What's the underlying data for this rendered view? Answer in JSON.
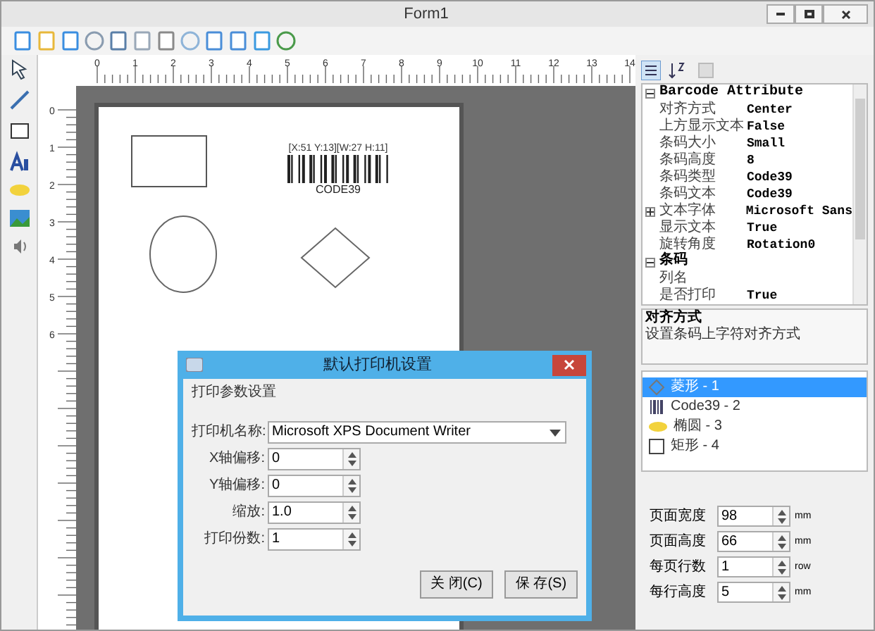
{
  "window": {
    "title": "Form1"
  },
  "rulers": {
    "top_labels": [
      "0",
      "1",
      "2",
      "3",
      "4",
      "5",
      "6",
      "7",
      "8",
      "9",
      "10",
      "11",
      "12",
      "13",
      "14"
    ],
    "left_labels": [
      "0",
      "1",
      "2",
      "3",
      "4",
      "5",
      "6"
    ]
  },
  "canvas": {
    "barcode": {
      "caption": "[X:51 Y:13][W:27 H:11]",
      "text": "CODE39"
    }
  },
  "property_grid": {
    "categories": [
      {
        "name": "Barcode Attribute",
        "expanded": true,
        "properties": [
          {
            "name": "对齐方式",
            "value": "Center",
            "expandable": false
          },
          {
            "name": "上方显示文本",
            "value": "False",
            "expandable": false
          },
          {
            "name": "条码大小",
            "value": "Small",
            "expandable": false
          },
          {
            "name": "条码高度",
            "value": "8",
            "expandable": false
          },
          {
            "name": "条码类型",
            "value": "Code39",
            "expandable": false
          },
          {
            "name": "条码文本",
            "value": "Code39",
            "expandable": false
          },
          {
            "name": "文本字体",
            "value": "Microsoft Sans",
            "expandable": true
          },
          {
            "name": "显示文本",
            "value": "True",
            "expandable": false
          },
          {
            "name": "旋转角度",
            "value": "Rotation0",
            "expandable": false
          }
        ]
      },
      {
        "name": "条码",
        "expanded": true,
        "properties": [
          {
            "name": "列名",
            "expandable": false
          },
          {
            "name": "是否打印",
            "value": "True",
            "expandable": false
          }
        ]
      }
    ]
  },
  "description": {
    "title": "对齐方式",
    "text": "设置条码上字符对齐方式"
  },
  "layers": [
    {
      "label": "菱形 - 1",
      "kind": "diamond",
      "selected": true
    },
    {
      "label": "Code39 - 2",
      "kind": "barcode",
      "selected": false
    },
    {
      "label": "椭圆 - 3",
      "kind": "ellipse",
      "selected": false
    },
    {
      "label": "矩形 - 4",
      "kind": "rectangle",
      "selected": false
    }
  ],
  "page_settings": [
    {
      "label": "页面宽度",
      "value": "98",
      "unit": "mm"
    },
    {
      "label": "页面高度",
      "value": "66",
      "unit": "mm"
    },
    {
      "label": "每页行数",
      "value": "1",
      "unit": "row"
    },
    {
      "label": "每行高度",
      "value": "5",
      "unit": "mm"
    }
  ],
  "dialog": {
    "title": "默认打印机设置",
    "group_title": "打印参数设置",
    "printer": {
      "label": "打印机名称:",
      "value": "Microsoft XPS Document Writer"
    },
    "fields": [
      {
        "label": "X轴偏移:",
        "value": "0"
      },
      {
        "label": "Y轴偏移:",
        "value": "0"
      },
      {
        "label": "缩放:",
        "value": "1.0"
      },
      {
        "label": "打印份数:",
        "value": "1"
      }
    ],
    "buttons": [
      "关 闭(C)",
      "保 存(S)"
    ]
  }
}
